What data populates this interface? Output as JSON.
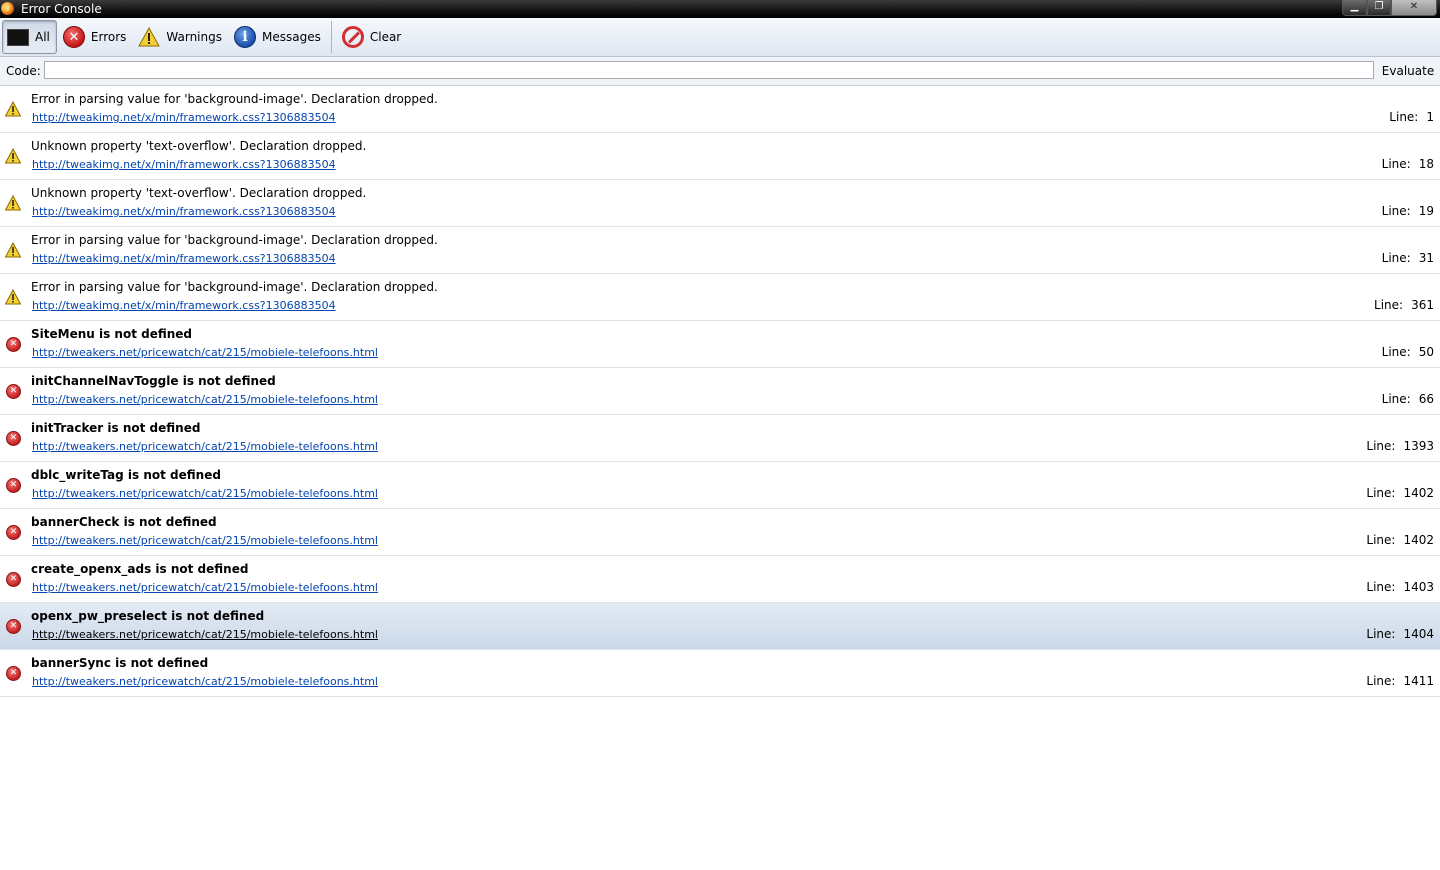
{
  "window": {
    "title": "Error Console",
    "buttons": [
      "minimize",
      "maximize",
      "close"
    ]
  },
  "toolbar": {
    "all_label": "All",
    "errors_label": "Errors",
    "warnings_label": "Warnings",
    "messages_label": "Messages",
    "clear_label": "Clear"
  },
  "codebar": {
    "code_label": "Code:",
    "code_value": "",
    "evaluate_label": "Evaluate"
  },
  "line_label": "Line:",
  "messages": [
    {
      "kind": "warning",
      "text": "Error in parsing value for 'background-image'.  Declaration dropped.",
      "url": "http://tweakimg.net/x/min/framework.css?1306883504",
      "line": "1"
    },
    {
      "kind": "warning",
      "text": "Unknown property 'text-overflow'.  Declaration dropped.",
      "url": "http://tweakimg.net/x/min/framework.css?1306883504",
      "line": "18"
    },
    {
      "kind": "warning",
      "text": "Unknown property 'text-overflow'.  Declaration dropped.",
      "url": "http://tweakimg.net/x/min/framework.css?1306883504",
      "line": "19"
    },
    {
      "kind": "warning",
      "text": "Error in parsing value for 'background-image'.  Declaration dropped.",
      "url": "http://tweakimg.net/x/min/framework.css?1306883504",
      "line": "31"
    },
    {
      "kind": "warning",
      "text": "Error in parsing value for 'background-image'.  Declaration dropped.",
      "url": "http://tweakimg.net/x/min/framework.css?1306883504",
      "line": "361"
    },
    {
      "kind": "error",
      "text": "SiteMenu is not defined",
      "url": "http://tweakers.net/pricewatch/cat/215/mobiele-telefoons.html",
      "line": "50"
    },
    {
      "kind": "error",
      "text": "initChannelNavToggle is not defined",
      "url": "http://tweakers.net/pricewatch/cat/215/mobiele-telefoons.html",
      "line": "66"
    },
    {
      "kind": "error",
      "text": "initTracker is not defined",
      "url": "http://tweakers.net/pricewatch/cat/215/mobiele-telefoons.html",
      "line": "1393"
    },
    {
      "kind": "error",
      "text": "dblc_writeTag is not defined",
      "url": "http://tweakers.net/pricewatch/cat/215/mobiele-telefoons.html",
      "line": "1402"
    },
    {
      "kind": "error",
      "text": "bannerCheck is not defined",
      "url": "http://tweakers.net/pricewatch/cat/215/mobiele-telefoons.html",
      "line": "1402"
    },
    {
      "kind": "error",
      "text": "create_openx_ads is not defined",
      "url": "http://tweakers.net/pricewatch/cat/215/mobiele-telefoons.html",
      "line": "1403"
    },
    {
      "kind": "error",
      "text": "openx_pw_preselect is not defined",
      "url": "http://tweakers.net/pricewatch/cat/215/mobiele-telefoons.html",
      "line": "1404",
      "selected": true
    },
    {
      "kind": "error",
      "text": "bannerSync is not defined",
      "url": "http://tweakers.net/pricewatch/cat/215/mobiele-telefoons.html",
      "line": "1411"
    }
  ]
}
